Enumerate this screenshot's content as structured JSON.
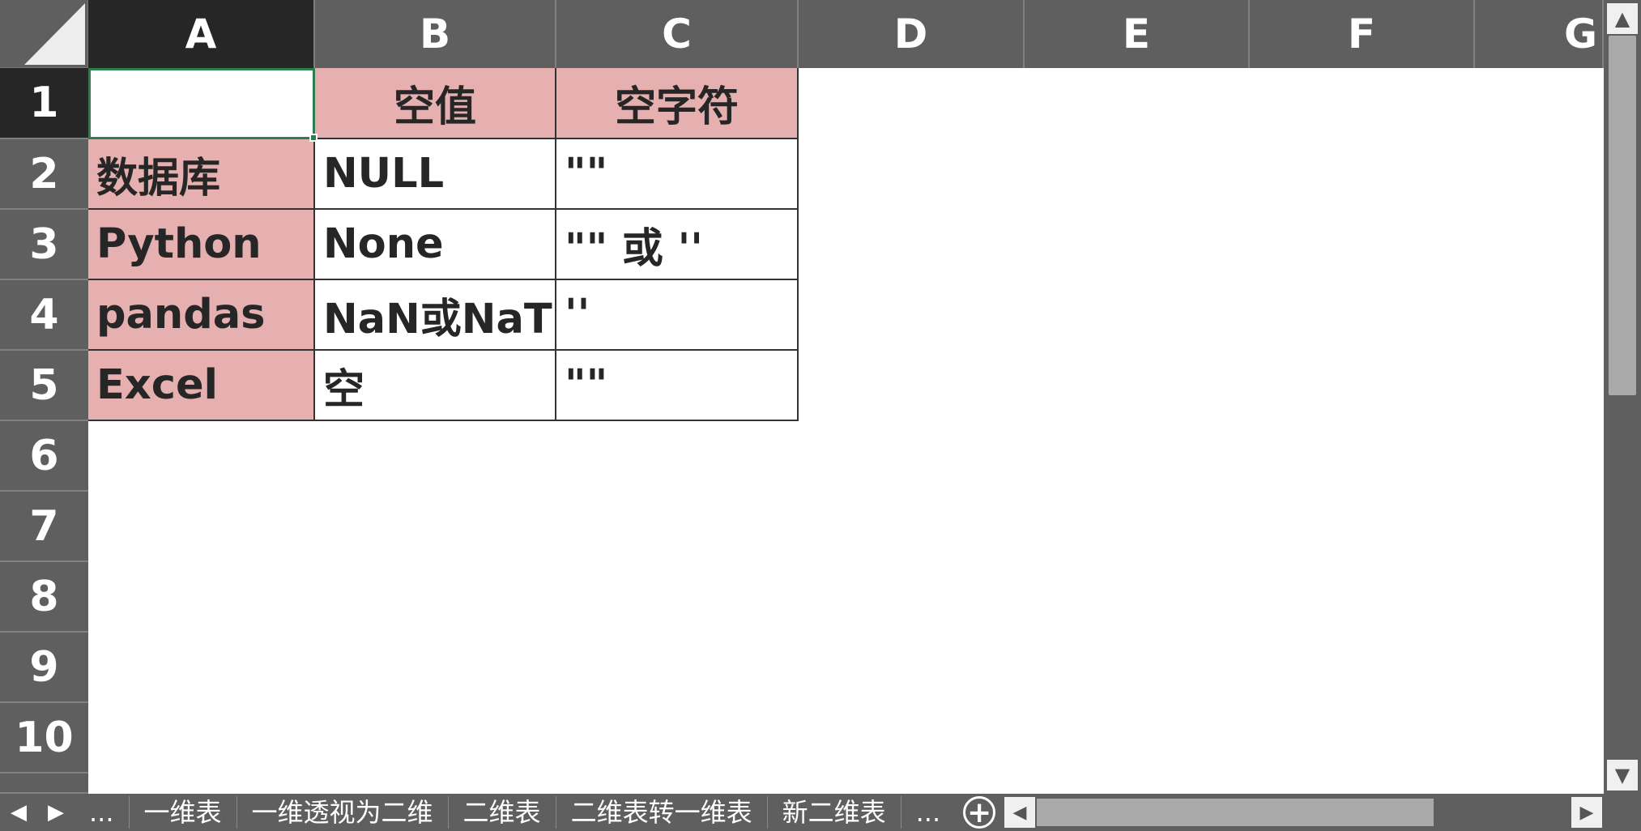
{
  "columns": [
    "A",
    "B",
    "C",
    "D",
    "E",
    "F",
    "G"
  ],
  "rows": [
    "1",
    "2",
    "3",
    "4",
    "5",
    "6",
    "7",
    "8",
    "9",
    "10"
  ],
  "cells": {
    "B1": "空值",
    "C1": "空字符",
    "A2": "数据库",
    "B2": "NULL",
    "C2": "\"\"",
    "A3": "Python",
    "B3": "None",
    "C3": "\"\" 或 ''",
    "A4": "pandas",
    "B4": "NaN或NaT",
    "C4": " ''",
    "A5": "Excel",
    "B5": "空",
    "C5": "\"\""
  },
  "sheet_tabs": {
    "more_left": "...",
    "tabs": [
      "一维表",
      "一维透视为二维",
      "二维表",
      "二维表转一维表",
      "新二维表"
    ],
    "more_right": "...",
    "add": "+"
  },
  "colors": {
    "header_bg": "#5f5f5f",
    "active_header_bg": "#262626",
    "pink_fill": "#e6b0b0",
    "selection": "#2e7d4f"
  }
}
